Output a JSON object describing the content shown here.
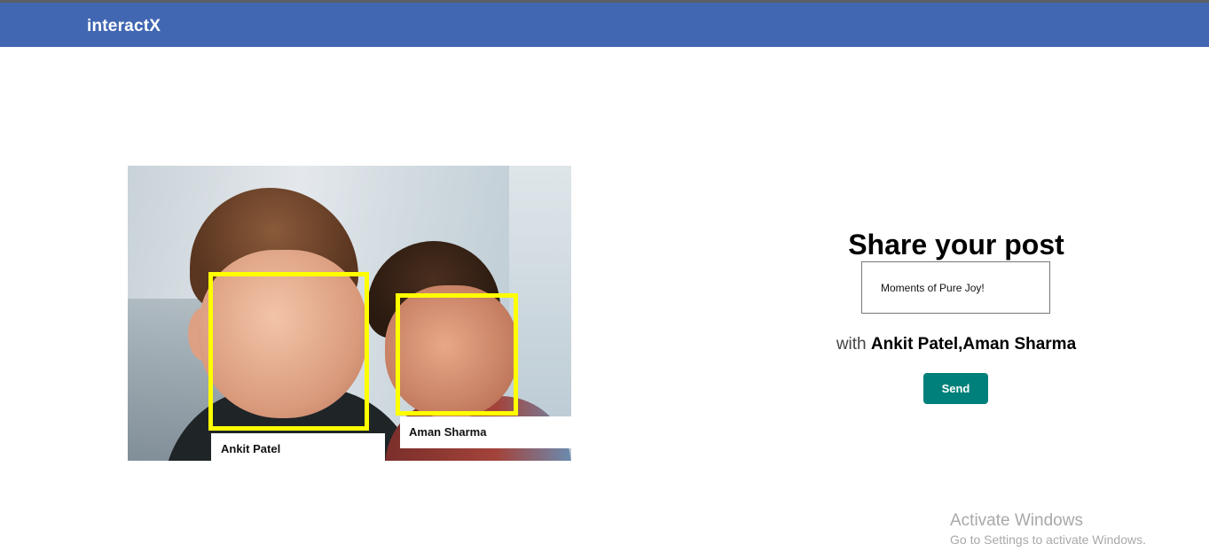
{
  "app": {
    "brand": "interactX"
  },
  "photo": {
    "tags": [
      {
        "name": "Ankit Patel"
      },
      {
        "name": "Aman Sharma"
      }
    ],
    "box_color": "#ffff00"
  },
  "share": {
    "title": "Share your post",
    "caption_value": "Moments of Pure Joy!",
    "with_word": "with",
    "tagged_people": "Ankit Patel,Aman Sharma",
    "send_label": "Send"
  },
  "colors": {
    "navbar": "#4267b2",
    "send_button": "#00807a"
  },
  "watermark": {
    "title": "Activate Windows",
    "subtitle": "Go to Settings to activate Windows."
  }
}
